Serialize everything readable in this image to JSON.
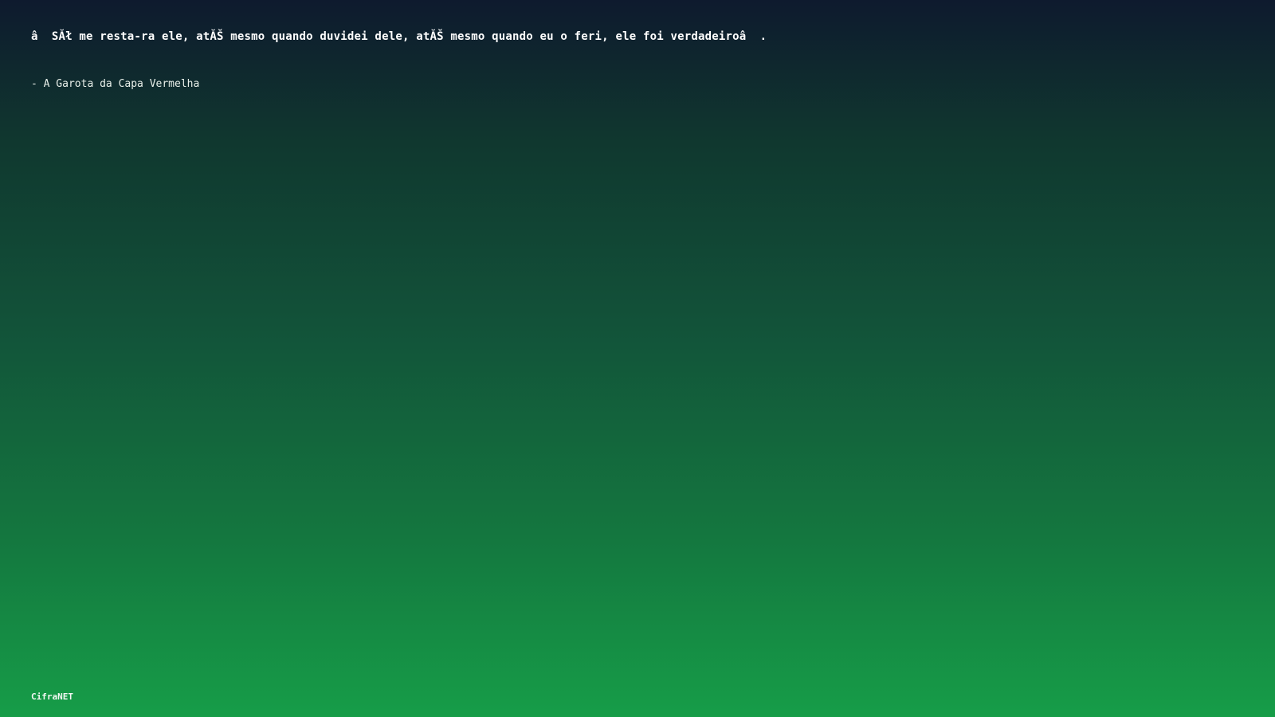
{
  "quote": {
    "text": "â  SĂł me resta-ra ele, atĂŠ mesmo quando duvidei dele, atĂŠ mesmo quando eu o feri, ele foi verdadeiroâ  ."
  },
  "author": {
    "text": "- A Garota da Capa Vermelha"
  },
  "footer": {
    "brand": "CifraNET"
  },
  "colors": {
    "background_top": "#0e1a2e",
    "background_bottom": "#169d48",
    "text": "#ffffff"
  }
}
